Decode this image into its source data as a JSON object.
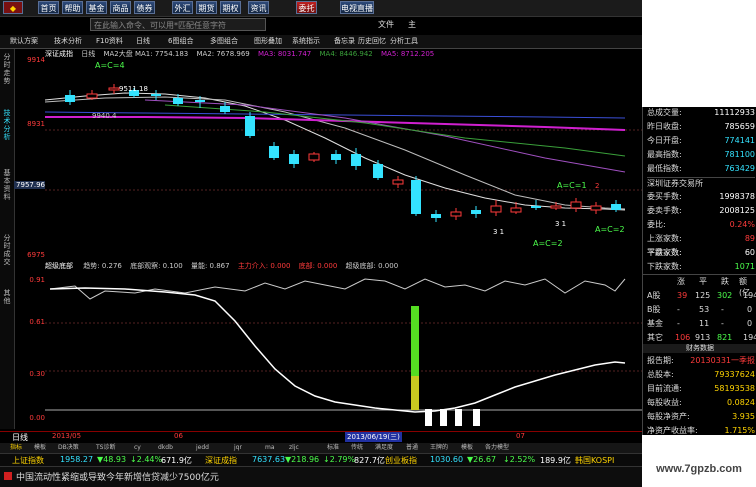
{
  "topbar": {
    "buttons": [
      "首页",
      "帮助",
      "基金",
      "商品",
      "债券",
      "外汇",
      "期货",
      "期权",
      "资讯",
      "委托",
      "电视直播"
    ]
  },
  "search": {
    "placeholder": "在此输入命令、可以用*匹配任意字符"
  },
  "menu": {
    "file": "文件",
    "view": "主"
  },
  "toolbar": {
    "items": [
      "默认方案",
      "技术分析",
      "F10资料",
      "日线",
      "6图组合",
      "多图组合",
      "图形叠加",
      "系统指示",
      "备忘录",
      "历史回忆",
      "分析工具"
    ]
  },
  "sidetabs": [
    "分时走势",
    "技术分析",
    "基本资料",
    "分时成交",
    "其他"
  ],
  "main_info": {
    "title": "深证成指",
    "period": "日线",
    "items": [
      "MA2大盘 MA1: 7754.183",
      "MA2: 7678.969",
      "MA3: 8031.747",
      "MA4: 8446.942",
      "MA5: 8712.205"
    ]
  },
  "annotations": {
    "ac4": "A=C=4",
    "high": "9511.18",
    "low": "9940.4",
    "c31a": "3 1",
    "c31b": "3 1",
    "ac2a": "A=C=2",
    "ac1": "A=C=1",
    "ac2b": "A=C=2",
    "n2": "2"
  },
  "y_axis": {
    "main": [
      "9914",
      "8931",
      "7957.96",
      "6975"
    ],
    "indicator": [
      "0.91",
      "0.61",
      "0.30",
      "0.00"
    ]
  },
  "indicator_info": {
    "title": "超级底部",
    "items": [
      "趋势: 0.276",
      "底部观察: 0.100",
      "量能: 0.867",
      "主力介入: 0.000",
      "底部: 0.000",
      "超级底部: 0.000"
    ]
  },
  "date_bar": {
    "period": "日线",
    "d1": "2013/05",
    "d2": "06",
    "cursor_date": "2013/06/19(三)",
    "d3": "07"
  },
  "tabs": [
    "指标",
    "模板",
    "DB决策",
    "TS诊断",
    "cy",
    "dkdb",
    "jedd",
    "jqr",
    "ma",
    "zljc",
    "标准",
    "传统",
    "满足度",
    "普通",
    "王牌的",
    "模板",
    "各力模型"
  ],
  "tickers": [
    {
      "name": "上证指数",
      "price": "1958.27",
      "change": "▼48.93",
      "pct": "↓2.44%",
      "vol": "671.9亿"
    },
    {
      "name": "深证成指",
      "price": "7637.63",
      "change": "▼218.96",
      "pct": "↓2.79%",
      "vol": "827.7亿"
    },
    {
      "name": "创业板指",
      "price": "1030.60",
      "change": "▼26.67",
      "pct": "↓2.52%",
      "vol": "189.9亿"
    },
    {
      "name": "韩国KOSPI",
      "price": "",
      "change": "",
      "pct": "",
      "vol": ""
    }
  ],
  "news": "中国流动性紧缩或导致今年新增信贷减少7500亿元",
  "right_panel": {
    "stats": [
      {
        "label": "总成交量:",
        "value": "11112933"
      },
      {
        "label": "昨日收盘:",
        "value": "785659"
      },
      {
        "label": "今日开盘:",
        "value": "774141"
      },
      {
        "label": "最高指数:",
        "value": "781100"
      },
      {
        "label": "最低指数:",
        "value": "763429"
      }
    ],
    "exchange": "深圳证券交易所",
    "buysell": [
      {
        "label": "委买手数:",
        "value": "1998378"
      },
      {
        "label": "委卖手数:",
        "value": "2008125"
      },
      {
        "label": "委比:",
        "value": "0.24%"
      },
      {
        "label": "上涨家数:",
        "value": "89"
      },
      {
        "label": "下跌家数:",
        "value": ""
      },
      {
        "label": "平盘家数:",
        "value": "60"
      },
      {
        "label": "下跌家数:",
        "value": "1071"
      }
    ],
    "breadth_headers": [
      "涨",
      "平",
      "跌",
      "额(亿"
    ],
    "breadth": [
      {
        "name": "A股",
        "up": "39",
        "flat": "125",
        "down": "302",
        "amt": "194"
      },
      {
        "name": "B股",
        "up": "-",
        "flat": "53",
        "down": "-",
        "amt": "0"
      },
      {
        "name": "基金",
        "up": "-",
        "flat": "11",
        "down": "-",
        "amt": "0"
      },
      {
        "name": "其它",
        "up": "106",
        "flat": "913",
        "down": "821",
        "amt": "194"
      }
    ],
    "fin_title": "财务数据",
    "fin": [
      {
        "label": "报告期:",
        "value": "20130331一季报"
      },
      {
        "label": "总股本:",
        "value": "79337624"
      },
      {
        "label": "目前流通:",
        "value": "58193538"
      },
      {
        "label": "每股收益:",
        "value": "0.0824"
      },
      {
        "label": "每股净资产:",
        "value": "3.935"
      },
      {
        "label": "净资产收益率:",
        "value": "1.715%"
      }
    ]
  },
  "watermark": "www.7gpzb.com",
  "colors": {
    "up": "#ff3b3b",
    "down": "#34e3ff",
    "ma_magenta": "#d020d0",
    "ma_green": "#3aa03a",
    "bar_green": "#55dd22"
  }
}
